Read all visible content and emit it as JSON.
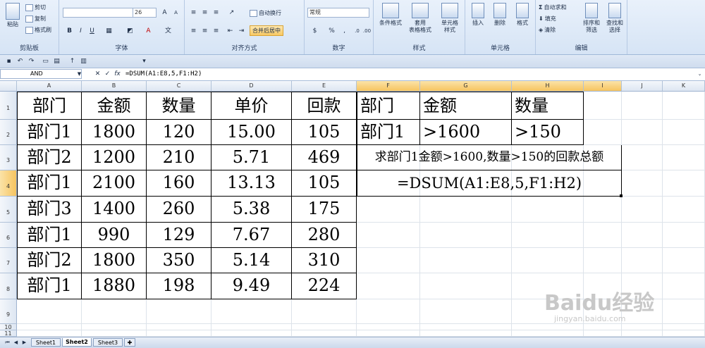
{
  "ribbon": {
    "clipboard": {
      "paste": "粘贴",
      "cut": "剪切",
      "copy": "复制",
      "format_painter": "格式刷",
      "label": "剪贴板"
    },
    "font": {
      "name": "",
      "size": "26",
      "label": "字体",
      "bold": "B",
      "italic": "I",
      "underline": "U",
      "font_color": "A"
    },
    "alignment": {
      "wrap": "自动换行",
      "merge": "合并后居中",
      "label": "对齐方式"
    },
    "number": {
      "format": "常规",
      "currency": "$",
      "percent": "%",
      "comma": ",",
      "label": "数字"
    },
    "styles": {
      "conditional": "条件格式",
      "table": "套用\n表格格式",
      "cell_styles": "单元格\n样式",
      "label": "样式"
    },
    "cells": {
      "insert": "插入",
      "delete": "删除",
      "format": "格式",
      "label": "单元格"
    },
    "editing": {
      "autosum": "自动求和",
      "fill": "填充",
      "clear": "清除",
      "sort": "排序和\n筛选",
      "find": "查找和\n选择",
      "label": "编辑"
    }
  },
  "formula_bar": {
    "name_box": "AND",
    "formula": "=DSUM(A1:E8,5,F1:H2)"
  },
  "columns": [
    "A",
    "B",
    "C",
    "D",
    "E",
    "F",
    "G",
    "H",
    "I",
    "J",
    "K"
  ],
  "rows": [
    "1",
    "2",
    "3",
    "4",
    "5",
    "6",
    "7",
    "8",
    "9",
    "10",
    "11"
  ],
  "table": {
    "headers": [
      "部门",
      "金额",
      "数量",
      "单价",
      "回款"
    ],
    "rows": [
      [
        "部门1",
        "1800",
        "120",
        "15.00",
        "105"
      ],
      [
        "部门2",
        "1200",
        "210",
        "5.71",
        "469"
      ],
      [
        "部门1",
        "2100",
        "160",
        "13.13",
        "105"
      ],
      [
        "部门3",
        "1400",
        "260",
        "5.38",
        "175"
      ],
      [
        "部门1",
        "990",
        "129",
        "7.67",
        "280"
      ],
      [
        "部门2",
        "1800",
        "350",
        "5.14",
        "310"
      ],
      [
        "部门1",
        "1880",
        "198",
        "9.49",
        "224"
      ]
    ]
  },
  "criteria": {
    "headers": [
      "部门",
      "金额",
      "数量"
    ],
    "values": [
      "部门1",
      ">1600",
      ">150"
    ]
  },
  "question": "求部门1金额>1600,数量>150的回款总额",
  "formula_display": "=DSUM(A1:E8,5,F1:H2)",
  "sheets": [
    "Sheet1",
    "Sheet2",
    "Sheet3"
  ],
  "active_sheet": "Sheet2",
  "watermark": {
    "brand": "Baidu经验",
    "url": "jingyan.baidu.com"
  }
}
